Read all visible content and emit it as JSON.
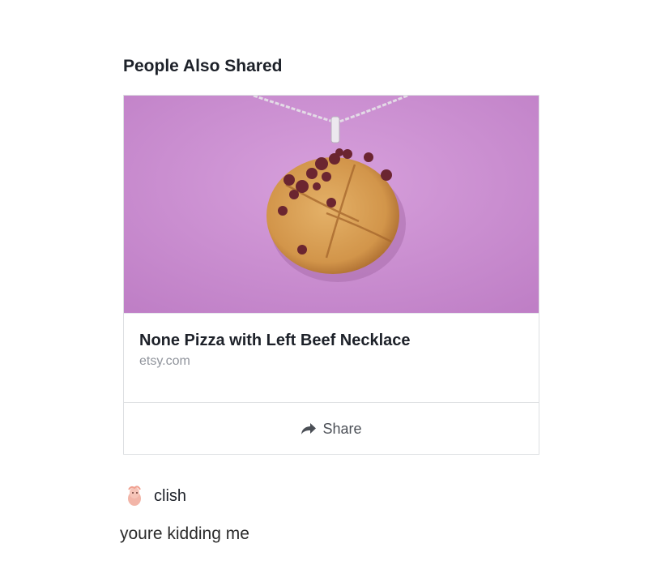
{
  "section": {
    "title": "People Also Shared"
  },
  "card": {
    "title": "None Pizza with Left Beef Necklace",
    "domain": "etsy.com",
    "share_label": "Share"
  },
  "comment": {
    "username": "clish",
    "text": "youre kidding me"
  },
  "colors": {
    "felt_background": "#c98bd0",
    "pizza_crust": "#d69a4e",
    "beef_topping": "#6b2530",
    "muted_text": "#90949c",
    "border": "#dddfe2"
  }
}
